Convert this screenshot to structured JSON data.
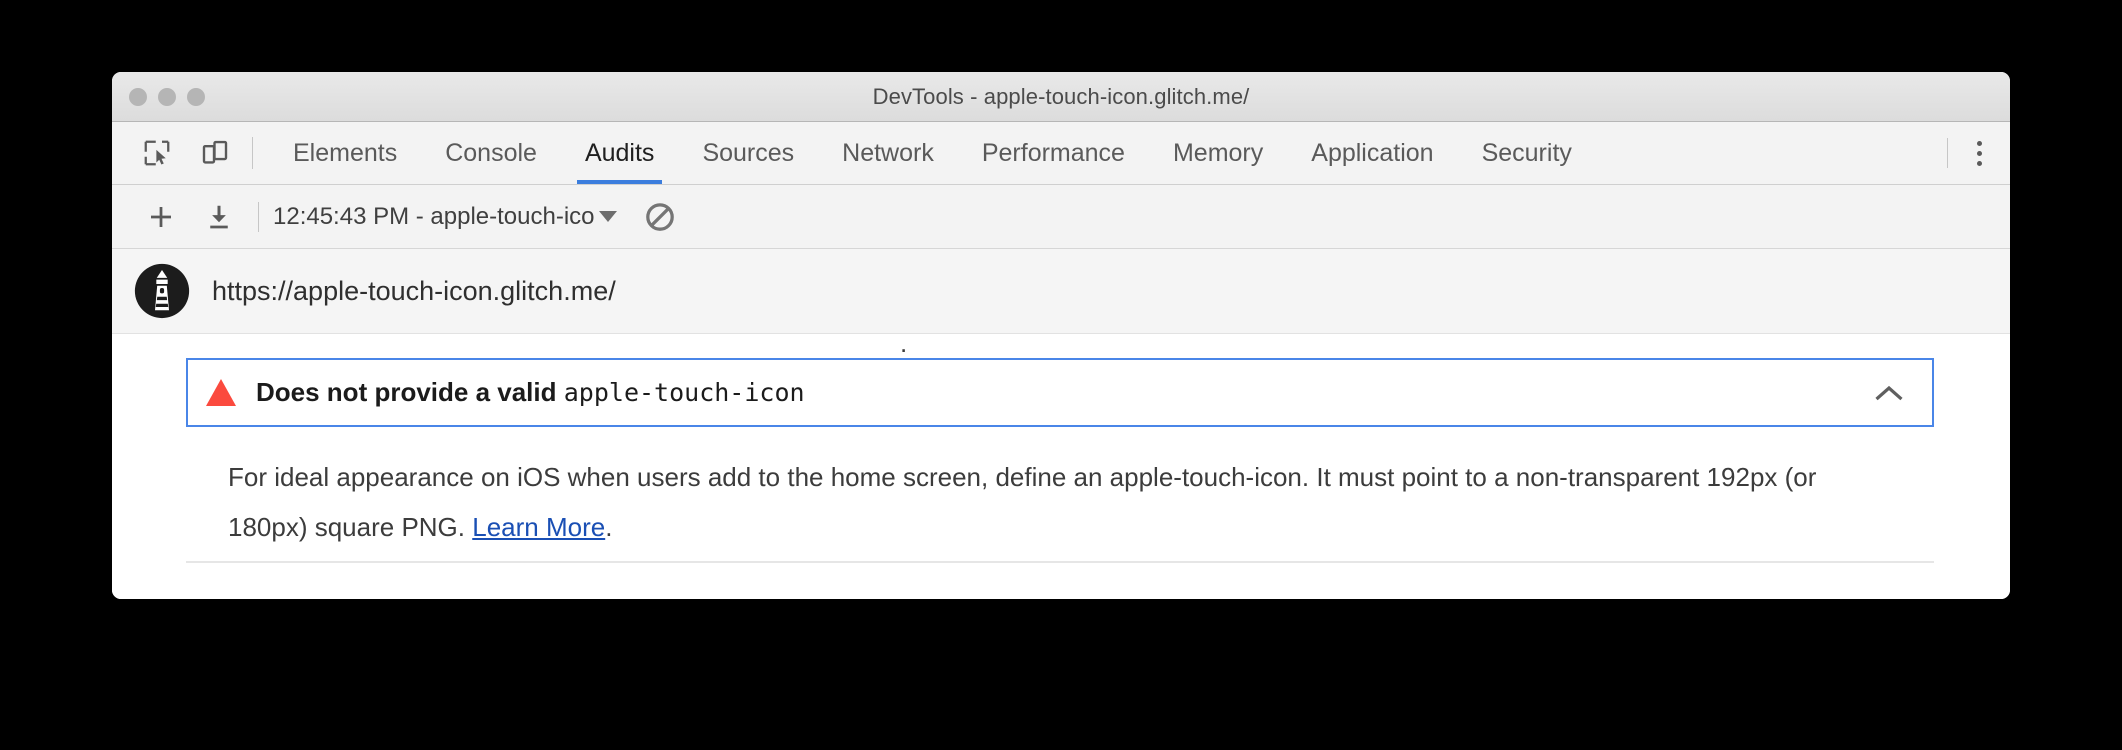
{
  "window": {
    "title": "DevTools - apple-touch-icon.glitch.me/",
    "traffic_lights": [
      "close",
      "minimize",
      "zoom"
    ]
  },
  "tabstrip": {
    "tools": [
      {
        "name": "inspect-element-icon",
        "label": "Inspect element"
      },
      {
        "name": "device-toolbar-icon",
        "label": "Toggle device toolbar"
      }
    ],
    "tabs": [
      {
        "label": "Elements",
        "active": false
      },
      {
        "label": "Console",
        "active": false
      },
      {
        "label": "Audits",
        "active": true
      },
      {
        "label": "Sources",
        "active": false
      },
      {
        "label": "Network",
        "active": false
      },
      {
        "label": "Performance",
        "active": false
      },
      {
        "label": "Memory",
        "active": false
      },
      {
        "label": "Application",
        "active": false
      },
      {
        "label": "Security",
        "active": false
      }
    ],
    "more_menu": "more-options-icon"
  },
  "audit_toolbar": {
    "add_label": "+",
    "add_icon": "plus-icon",
    "export_icon": "download-icon",
    "report_select": "12:45:43 PM - apple-touch-ico",
    "report_select_caret": "chevron-down-icon",
    "clear_icon": "clear-all-icon"
  },
  "url_row": {
    "favicon": "lighthouse-icon",
    "url": "https://apple-touch-icon.glitch.me/"
  },
  "report": {
    "clipped_text": ".",
    "audit": {
      "status_icon": "warning-triangle-icon",
      "status_color": "#fb4a3e",
      "title_prefix": "Does not provide a valid ",
      "title_code": "apple-touch-icon",
      "collapse_icon": "chevron-up-icon",
      "focus_border_color": "#4a86e8",
      "description_before_link": "For ideal appearance on iOS when users add to the home screen, define an apple-touch-icon. It must point to a non-transparent 192px (or 180px) square PNG. ",
      "link_label": "Learn More",
      "description_after_link": "."
    }
  }
}
